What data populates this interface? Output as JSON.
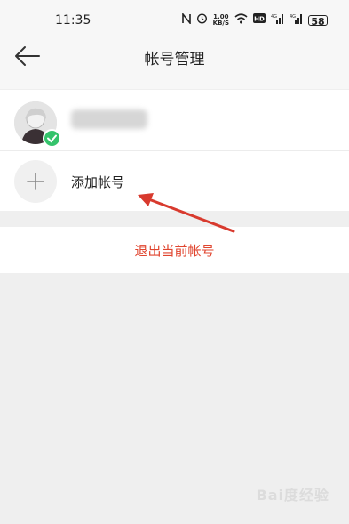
{
  "status_bar": {
    "time": "11:35",
    "net_speed_value": "1.00",
    "net_speed_unit": "KB/S",
    "battery": "58"
  },
  "header": {
    "title": "帐号管理",
    "back_icon": "arrow-left-icon"
  },
  "accounts": {
    "current_username": "",
    "add_account_label": "添加帐号",
    "add_icon": "plus-icon",
    "check_icon": "check-icon"
  },
  "logout": {
    "label": "退出当前帐号",
    "color": "#e0452f"
  },
  "watermark": {
    "text": "Bai度经验"
  },
  "colors": {
    "accent_red": "#e0452f",
    "check_green": "#34c36b",
    "page_bg": "#efefef"
  }
}
